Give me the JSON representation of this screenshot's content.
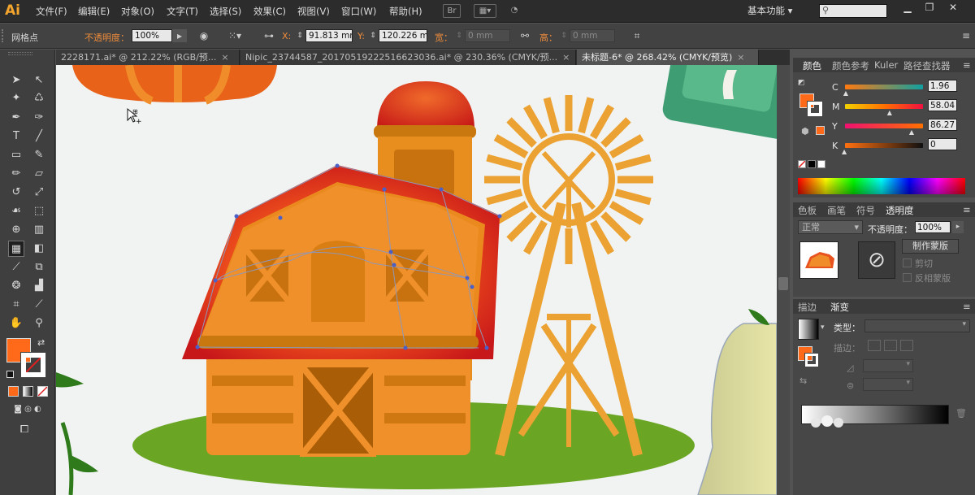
{
  "app": {
    "logo": "Ai"
  },
  "menu": [
    "文件(F)",
    "编辑(E)",
    "对象(O)",
    "文字(T)",
    "选择(S)",
    "效果(C)",
    "视图(V)",
    "窗口(W)",
    "帮助(H)"
  ],
  "menubar_icons": {
    "bridge": "Br"
  },
  "workspace": "基本功能",
  "controlbar": {
    "selection_label": "网格点",
    "opacity_label": "不透明度：",
    "opacity_value": "100%",
    "x_label": "X:",
    "x_value": "91.813 mm",
    "y_label": "Y:",
    "y_value": "120.226 m",
    "w_label": "宽：",
    "w_value": "0 mm",
    "h_label": "高：",
    "h_value": "0 mm"
  },
  "tabs": [
    {
      "label": "2228171.ai* @ 212.22% (RGB/预...",
      "close": "×",
      "active": false
    },
    {
      "label": "Nipic_23744587_20170519222516623036.ai* @ 230.36% (CMYK/预...",
      "close": "×",
      "active": false
    },
    {
      "label": "未标题-6* @ 268.42% (CMYK/预览)",
      "close": "×",
      "active": true
    }
  ],
  "color_panel": {
    "tabs": [
      "颜色",
      "颜色参考",
      "Kuler",
      "路径查找器"
    ],
    "channels": [
      {
        "name": "C",
        "value": "1.96",
        "pct": 0.0196
      },
      {
        "name": "M",
        "value": "58.04",
        "pct": 0.5804
      },
      {
        "name": "Y",
        "value": "86.27",
        "pct": 0.8627
      },
      {
        "name": "K",
        "value": "0",
        "pct": 0.0
      }
    ]
  },
  "transparency_panel": {
    "tabs": [
      "色板",
      "画笔",
      "符号",
      "透明度"
    ],
    "blend_mode": "正常",
    "opacity_label": "不透明度：",
    "opacity_value": "100%",
    "make_mask_button": "制作蒙版",
    "clip_label": "剪切",
    "invert_label": "反相蒙版"
  },
  "gradient_panel": {
    "tabs": [
      "描边",
      "渐变"
    ],
    "type_label": "类型：",
    "stroke_label": "描边："
  },
  "colors": {
    "fill": "#ff6a1a",
    "accent": "#f4a52d",
    "barn_orange": "#f0902a",
    "roof_red": "#d8281a",
    "windmill": "#eba232",
    "grass": "#6aa624"
  }
}
